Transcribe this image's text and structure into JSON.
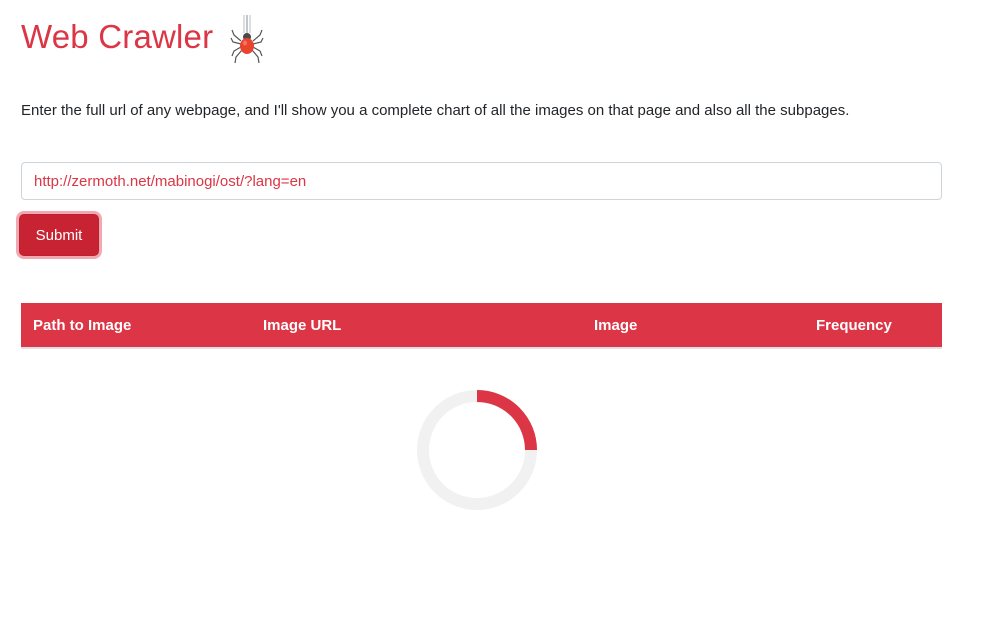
{
  "header": {
    "title": "Web Crawler",
    "logo_icon": "spider-icon"
  },
  "intro": {
    "text": "Enter the full url of any webpage, and I'll show you a complete chart of all the images on that page and also all the subpages."
  },
  "form": {
    "url_value": "http://zermoth.net/mabinogi/ost/?lang=en",
    "submit_label": "Submit"
  },
  "table": {
    "columns": [
      "Path to Image",
      "Image URL",
      "Image",
      "Frequency"
    ],
    "rows": []
  },
  "loading": {
    "icon": "loading-spinner-icon"
  },
  "colors": {
    "accent": "#dc3545",
    "button": "#c82333",
    "spinner_track": "#f1f1f1"
  }
}
